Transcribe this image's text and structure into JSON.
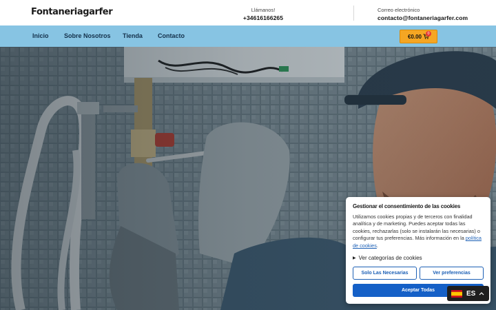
{
  "header": {
    "logo": "Fontaneriagarfer",
    "phone_label": "Llámanos!",
    "phone": "+34616166265",
    "email_label": "Correo electrónico",
    "email": "contacto@fontaneriagarfer.com"
  },
  "nav": {
    "items": [
      "Inicio",
      "Sobre Nosotros",
      "Tienda",
      "Contacto"
    ],
    "cart_total": "€0.00",
    "cart_count": "0"
  },
  "cookie_banner": {
    "title": "Gestionar el consentimiento de las cookies",
    "text_before_link": "Utilizamos cookies propias y de terceros con finalidad analítica y de marketing. Puedes aceptar todas las cookies, rechazarlas (solo se instalarán las necesarias) o configurar tus preferencias. Más información en la ",
    "link_text": "política de cookies",
    "text_after_link": ".",
    "categories_label": "Ver categorías de cookies",
    "btn_necessary": "Solo Las Necesarias",
    "btn_preferences": "Ver preferencias",
    "btn_accept": "Aceptar Todas"
  },
  "language": {
    "code": "ES",
    "flag_icon": "spain-flag-icon"
  },
  "colors": {
    "nav_bg": "#87c4e3",
    "cart_bg": "#f5a623",
    "accent_blue": "#1560c7"
  }
}
